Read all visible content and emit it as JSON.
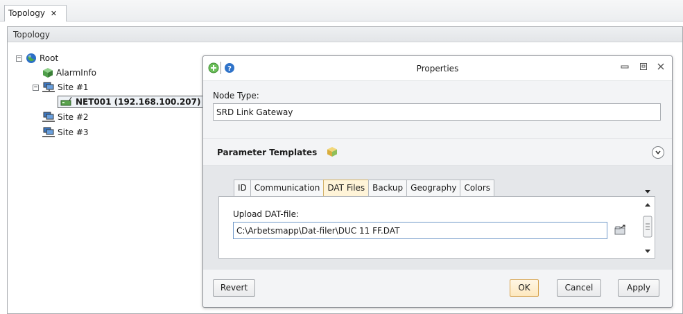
{
  "document_tab": {
    "label": "Topology",
    "close": "✕"
  },
  "panel": {
    "title": "Topology"
  },
  "tree": {
    "root": {
      "label": "Root",
      "expander": "−"
    },
    "alarm": {
      "label": "AlarmInfo"
    },
    "site1": {
      "label": "Site #1",
      "expander": "−"
    },
    "net001": {
      "label": "NET001 (192.168.100.207)"
    },
    "site2": {
      "label": "Site #2"
    },
    "site3": {
      "label": "Site #3"
    }
  },
  "dialog": {
    "title": "Properties",
    "node_type_label": "Node Type:",
    "node_type_value": "SRD Link Gateway",
    "section_title": "Parameter Templates",
    "tabs": [
      "ID",
      "Communication",
      "DAT Files",
      "Backup",
      "Geography",
      "Colors"
    ],
    "active_tab": "DAT Files",
    "upload_label": "Upload DAT-file:",
    "upload_value": "C:\\Arbetsmapp\\Dat-filer\\DUC 11 FF.DAT",
    "buttons": {
      "revert": "Revert",
      "ok": "OK",
      "cancel": "Cancel",
      "apply": "Apply"
    }
  },
  "colors": {
    "accent_tab": "#fff4d8",
    "default_button_border": "#d6a14a"
  }
}
